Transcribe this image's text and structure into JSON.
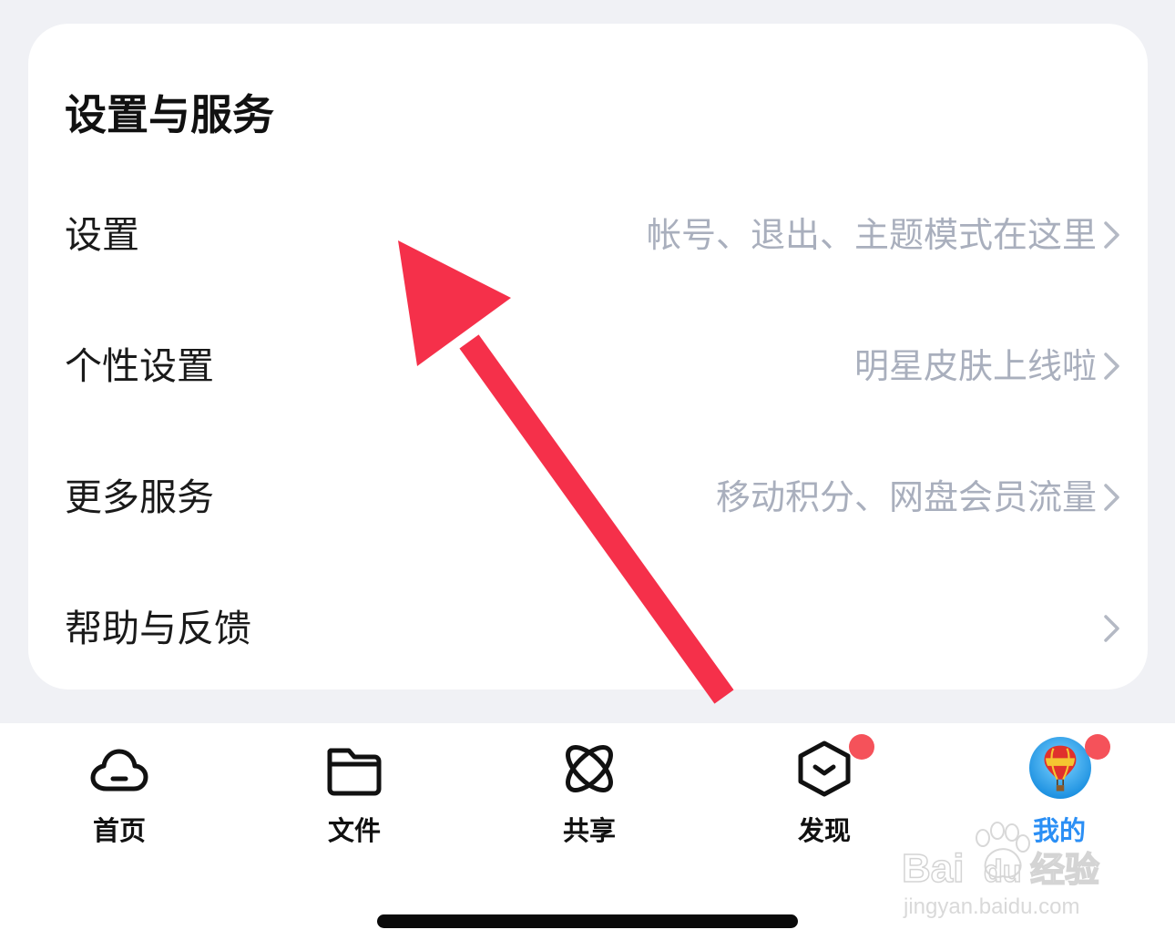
{
  "section": {
    "title": "设置与服务",
    "rows": [
      {
        "label": "设置",
        "hint": "帐号、退出、主题模式在这里"
      },
      {
        "label": "个性设置",
        "hint": "明星皮肤上线啦"
      },
      {
        "label": "更多服务",
        "hint": "移动积分、网盘会员流量"
      },
      {
        "label": "帮助与反馈",
        "hint": ""
      }
    ]
  },
  "tabbar": {
    "tabs": [
      {
        "label": "首页",
        "icon": "cloud-icon",
        "badge": false,
        "active": false
      },
      {
        "label": "文件",
        "icon": "folder-icon",
        "badge": false,
        "active": false
      },
      {
        "label": "共享",
        "icon": "orbit-icon",
        "badge": false,
        "active": false
      },
      {
        "label": "发现",
        "icon": "box-icon",
        "badge": true,
        "active": false
      },
      {
        "label": "我的",
        "icon": "avatar-balloon",
        "badge": true,
        "active": true
      }
    ]
  },
  "watermark": {
    "logo_text": "Baidu经验",
    "url": "jingyan.baidu.com"
  },
  "colors": {
    "background": "#f0f1f5",
    "accent": "#2b8ff5",
    "badge": "#f5525a",
    "hint": "#a9afbd",
    "annotation_arrow": "#f5304a"
  }
}
